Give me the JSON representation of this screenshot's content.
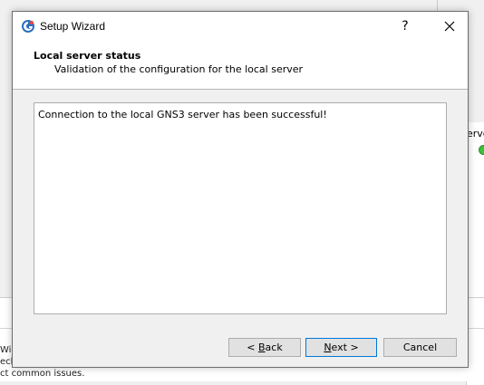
{
  "background": {
    "right_panel_fragment": "erve",
    "bottom_fragments": [
      "Wi",
      "echnologies",
      "ct common issues."
    ]
  },
  "dialog": {
    "title": "Setup Wizard",
    "help_label": "?",
    "header_title": "Local server status",
    "header_subtitle": "Validation of the configuration for the local server",
    "content_message": "Connection to the local GNS3 server has been successful!",
    "buttons": {
      "back": {
        "accel": "B",
        "rest": "ack",
        "prefix": "< "
      },
      "next": {
        "accel": "N",
        "rest": "ext >"
      },
      "cancel": "Cancel"
    }
  },
  "colors": {
    "accent": "#0078d7",
    "status_dot": "#39c23a"
  }
}
